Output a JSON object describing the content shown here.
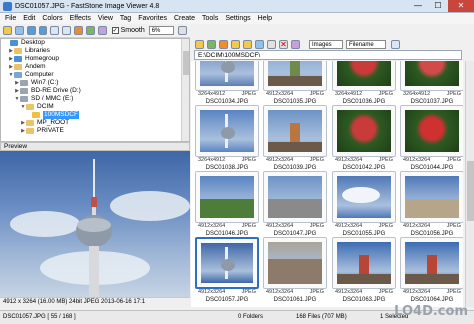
{
  "window": {
    "title": "DSC01057.JPG - FastStone Image Viewer 4.8",
    "buttons": {
      "minimize": "—",
      "maximize": "☐",
      "close": "✕"
    }
  },
  "menu": [
    "File",
    "Edit",
    "Colors",
    "Effects",
    "View",
    "Tag",
    "Favorites",
    "Create",
    "Tools",
    "Settings",
    "Help"
  ],
  "toolbar": {
    "smooth_label": "Smooth",
    "zoom_value": "6%"
  },
  "tree": {
    "items": [
      {
        "label": "Desktop"
      },
      {
        "label": "Libraries"
      },
      {
        "label": "Homegroup"
      },
      {
        "label": "Andem"
      },
      {
        "label": "Computer"
      },
      {
        "label": "Win7 (C:)"
      },
      {
        "label": "BD-RE Drive (D:)"
      },
      {
        "label": "SD / MMC (E:)"
      },
      {
        "label": "DCIM"
      },
      {
        "label": "100MSDCF"
      },
      {
        "label": "MP_ROOT"
      },
      {
        "label": "PRIVATE"
      }
    ]
  },
  "preview": {
    "header": "Preview",
    "info": "4912 x 3264 (16.00 MB) 24bit JPEG    2013-06-16 17:1"
  },
  "browser": {
    "filter_value": "Images",
    "sort_value": "Filename",
    "path": "E:\\DCIM\\100MSDCF\\"
  },
  "thumbnails": [
    {
      "meta": "3264x4912",
      "type": "JPEG",
      "name": "DSC01034.JPG"
    },
    {
      "meta": "4912x3264",
      "type": "JPEG",
      "name": "DSC01035.JPG"
    },
    {
      "meta": "3264x4912",
      "type": "JPEG",
      "name": "DSC01036.JPG"
    },
    {
      "meta": "3264x4912",
      "type": "JPEG",
      "name": "DSC01037.JPG"
    },
    {
      "meta": "3264x4912",
      "type": "JPEG",
      "name": "DSC01038.JPG"
    },
    {
      "meta": "4912x3264",
      "type": "JPEG",
      "name": "DSC01039.JPG"
    },
    {
      "meta": "4912x3264",
      "type": "JPEG",
      "name": "DSC01042.JPG"
    },
    {
      "meta": "4912x3264",
      "type": "JPEG",
      "name": "DSC01044.JPG"
    },
    {
      "meta": "4912x3264",
      "type": "JPEG",
      "name": "DSC01046.JPG"
    },
    {
      "meta": "4912x3264",
      "type": "JPEG",
      "name": "DSC01047.JPG"
    },
    {
      "meta": "4912x3264",
      "type": "JPEG",
      "name": "DSC01055.JPG"
    },
    {
      "meta": "4912x3264",
      "type": "JPEG",
      "name": "DSC01056.JPG"
    },
    {
      "meta": "4912x3264",
      "type": "JPEG",
      "name": "DSC01057.JPG"
    },
    {
      "meta": "4912x3264",
      "type": "JPEG",
      "name": "DSC01061.JPG"
    },
    {
      "meta": "4912x3264",
      "type": "JPEG",
      "name": "DSC01063.JPG"
    },
    {
      "meta": "4912x3264",
      "type": "JPEG",
      "name": "DSC01064.JPG"
    }
  ],
  "status": {
    "file": "DSC01057.JPG [ 55 / 168 ]",
    "folders": "0 Folders",
    "files": "168 Files (707 MB)",
    "selected": "1 Selected"
  },
  "watermark": "LO4D.com",
  "colors": {
    "accent": "#2e6fc4",
    "sky": "#5b7fb8",
    "close": "#c8463c"
  }
}
